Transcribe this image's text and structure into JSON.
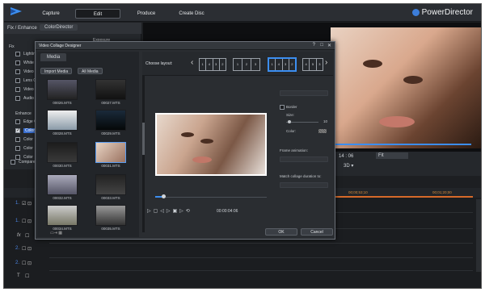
{
  "app": {
    "brand": "PowerDirector"
  },
  "nav": {
    "tabs": [
      "Capture",
      "Edit",
      "Produce",
      "Create Disc"
    ],
    "active": "Edit"
  },
  "fix_panel": {
    "title": "Fix / Enhance",
    "tab": "ColorDirector",
    "section_fix": "Fix",
    "fix_items": [
      "Lightin",
      "White",
      "Video",
      "Lens C",
      "Video",
      "Audio"
    ],
    "section_enhance": "Enhance",
    "enhance_items": [
      "Edge C",
      "Color",
      "Color",
      "Color",
      "Color"
    ],
    "compare": "Compare",
    "exposure_label": "Exposure"
  },
  "preview": {
    "timecode": "14 : 06",
    "fit": "Fit"
  },
  "timeline": {
    "ruler": [
      "00;00;26;20",
      "00;00;53;10",
      "00;01;20;00"
    ]
  },
  "dialog": {
    "title": "Video Collage Designer",
    "media_tab": "Media",
    "import_button": "Import Media",
    "filter": "All Media",
    "thumbnails": [
      {
        "label": "00026.MTS"
      },
      {
        "label": "00027.MTS"
      },
      {
        "label": "00028.MTS"
      },
      {
        "label": "00029.MTS"
      },
      {
        "label": "00030.MTS"
      },
      {
        "label": "00031.MTS"
      },
      {
        "label": "00032.MTS"
      },
      {
        "label": "00033.MTS"
      },
      {
        "label": "00034.MTS"
      },
      {
        "label": "00035.MTS"
      }
    ],
    "choose_layout": "Choose layout:",
    "border_label": "Border",
    "size_label": "Size:",
    "size_value": "10",
    "color_label": "Color:",
    "frame_anim_label": "Frame animation:",
    "match_duration_label": "Match collage duration to:",
    "timecode": "00:00:04:06",
    "ok": "OK",
    "cancel": "Cancel"
  }
}
